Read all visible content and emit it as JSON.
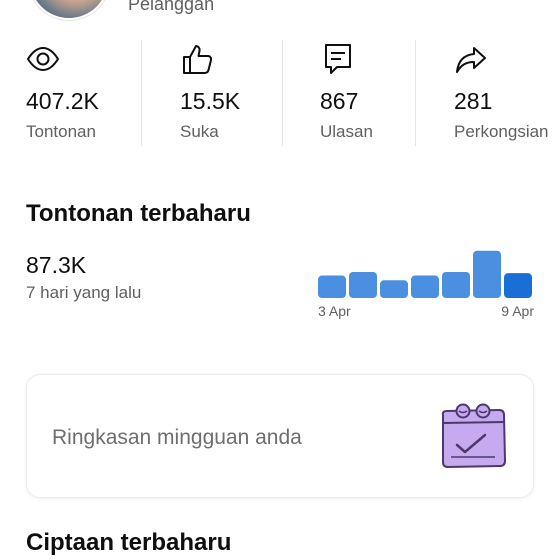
{
  "header": {
    "subscriber_label": "Pelanggan"
  },
  "stats": [
    {
      "icon": "eye-icon",
      "value": "407.2K",
      "label": "Tontonan"
    },
    {
      "icon": "thumbs-up-icon",
      "value": "15.5K",
      "label": "Suka"
    },
    {
      "icon": "comment-icon",
      "value": "867",
      "label": "Ulasan"
    },
    {
      "icon": "share-icon",
      "value": "281",
      "label": "Perkongsian"
    }
  ],
  "recent_views": {
    "title": "Tontonan terbaharu",
    "value": "87.3K",
    "subtitle": "7 hari yang lalu"
  },
  "chart_data": {
    "type": "bar",
    "title": "",
    "xlabel": "",
    "ylabel": "",
    "categories": [
      "3 Apr",
      "",
      "",
      "",
      "",
      "",
      "9 Apr"
    ],
    "tick_labels": [
      "3 Apr",
      "9 Apr"
    ],
    "values": [
      9.5,
      11,
      7.5,
      9.5,
      11,
      20,
      10.5
    ],
    "ylim": [
      0,
      22
    ],
    "grid": false,
    "colors": {
      "bar": "#4a8fe0",
      "highlight": "#1a6fd6"
    },
    "highlight_index": 6
  },
  "summary_card": {
    "text": "Ringkasan mingguan anda",
    "icon": "calendar-check-icon"
  },
  "recent_creations": {
    "title": "Ciptaan terbaharu"
  },
  "colors": {
    "text_primary": "#0f0f0f",
    "text_secondary": "#606060",
    "illustration": "#c7a9ef"
  }
}
